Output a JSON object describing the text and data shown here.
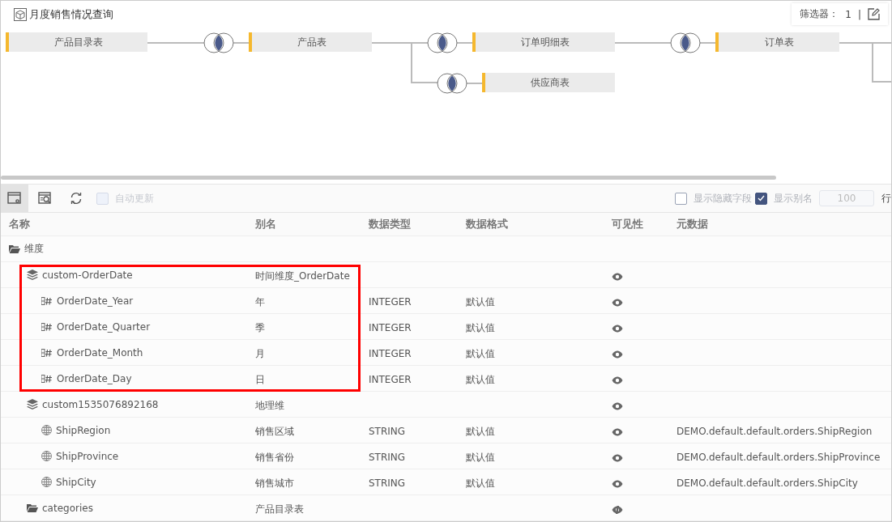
{
  "title": "月度销售情况查询",
  "filter": {
    "label": "筛选器：",
    "count": "1",
    "separator": "|"
  },
  "diagram": {
    "nodes": [
      {
        "label": "产品目录表"
      },
      {
        "label": "产品表"
      },
      {
        "label": "订单明细表"
      },
      {
        "label": "订单表"
      },
      {
        "label": "供应商表"
      }
    ]
  },
  "toolbar": {
    "tool_buttons": [
      {
        "selected": true
      },
      {
        "selected": false
      },
      {
        "selected": false
      }
    ],
    "auto_update": {
      "label": "自动更新",
      "checked": false,
      "disabled": true
    },
    "show_hidden": {
      "label": "显示隐藏字段",
      "checked": false
    },
    "show_alias": {
      "label": "显示别名",
      "checked": true
    },
    "row_limit": {
      "value": "100",
      "disabled": true
    },
    "row_label": "行"
  },
  "table": {
    "columns": [
      "名称",
      "别名",
      "数据类型",
      "数据格式",
      "可见性",
      "元数据"
    ],
    "rows": [
      {
        "kind": "folder",
        "name": "维度",
        "highlighted": false,
        "children": [
          {
            "kind": "hierarchy",
            "name": "custom-OrderDate",
            "alias": "时间维度_OrderDate",
            "visible": true,
            "highlighted": true,
            "children": [
              {
                "kind": "number",
                "name": "OrderDate_Year",
                "alias": "年",
                "type": "INTEGER",
                "format": "默认值",
                "visible": true
              },
              {
                "kind": "number",
                "name": "OrderDate_Quarter",
                "alias": "季",
                "type": "INTEGER",
                "format": "默认值",
                "visible": true
              },
              {
                "kind": "number",
                "name": "OrderDate_Month",
                "alias": "月",
                "type": "INTEGER",
                "format": "默认值",
                "visible": true
              },
              {
                "kind": "number",
                "name": "OrderDate_Day",
                "alias": "日",
                "type": "INTEGER",
                "format": "默认值",
                "visible": true
              }
            ]
          },
          {
            "kind": "hierarchy",
            "name": "custom1535076892168",
            "alias": "地理维",
            "visible": true,
            "highlighted": false,
            "children": [
              {
                "kind": "geo",
                "name": "ShipRegion",
                "alias": "销售区域",
                "type": "STRING",
                "format": "默认值",
                "visible": true,
                "metadata": "DEMO.default.default.orders.ShipRegion"
              },
              {
                "kind": "geo",
                "name": "ShipProvince",
                "alias": "销售省份",
                "type": "STRING",
                "format": "默认值",
                "visible": true,
                "metadata": "DEMO.default.default.orders.ShipProvince"
              },
              {
                "kind": "geo",
                "name": "ShipCity",
                "alias": "销售城市",
                "type": "STRING",
                "format": "默认值",
                "visible": true,
                "metadata": "DEMO.default.default.orders.ShipCity"
              }
            ]
          },
          {
            "kind": "folder",
            "name": "categories",
            "alias": "产品目录表",
            "visible": false,
            "highlighted": false
          }
        ]
      }
    ]
  }
}
